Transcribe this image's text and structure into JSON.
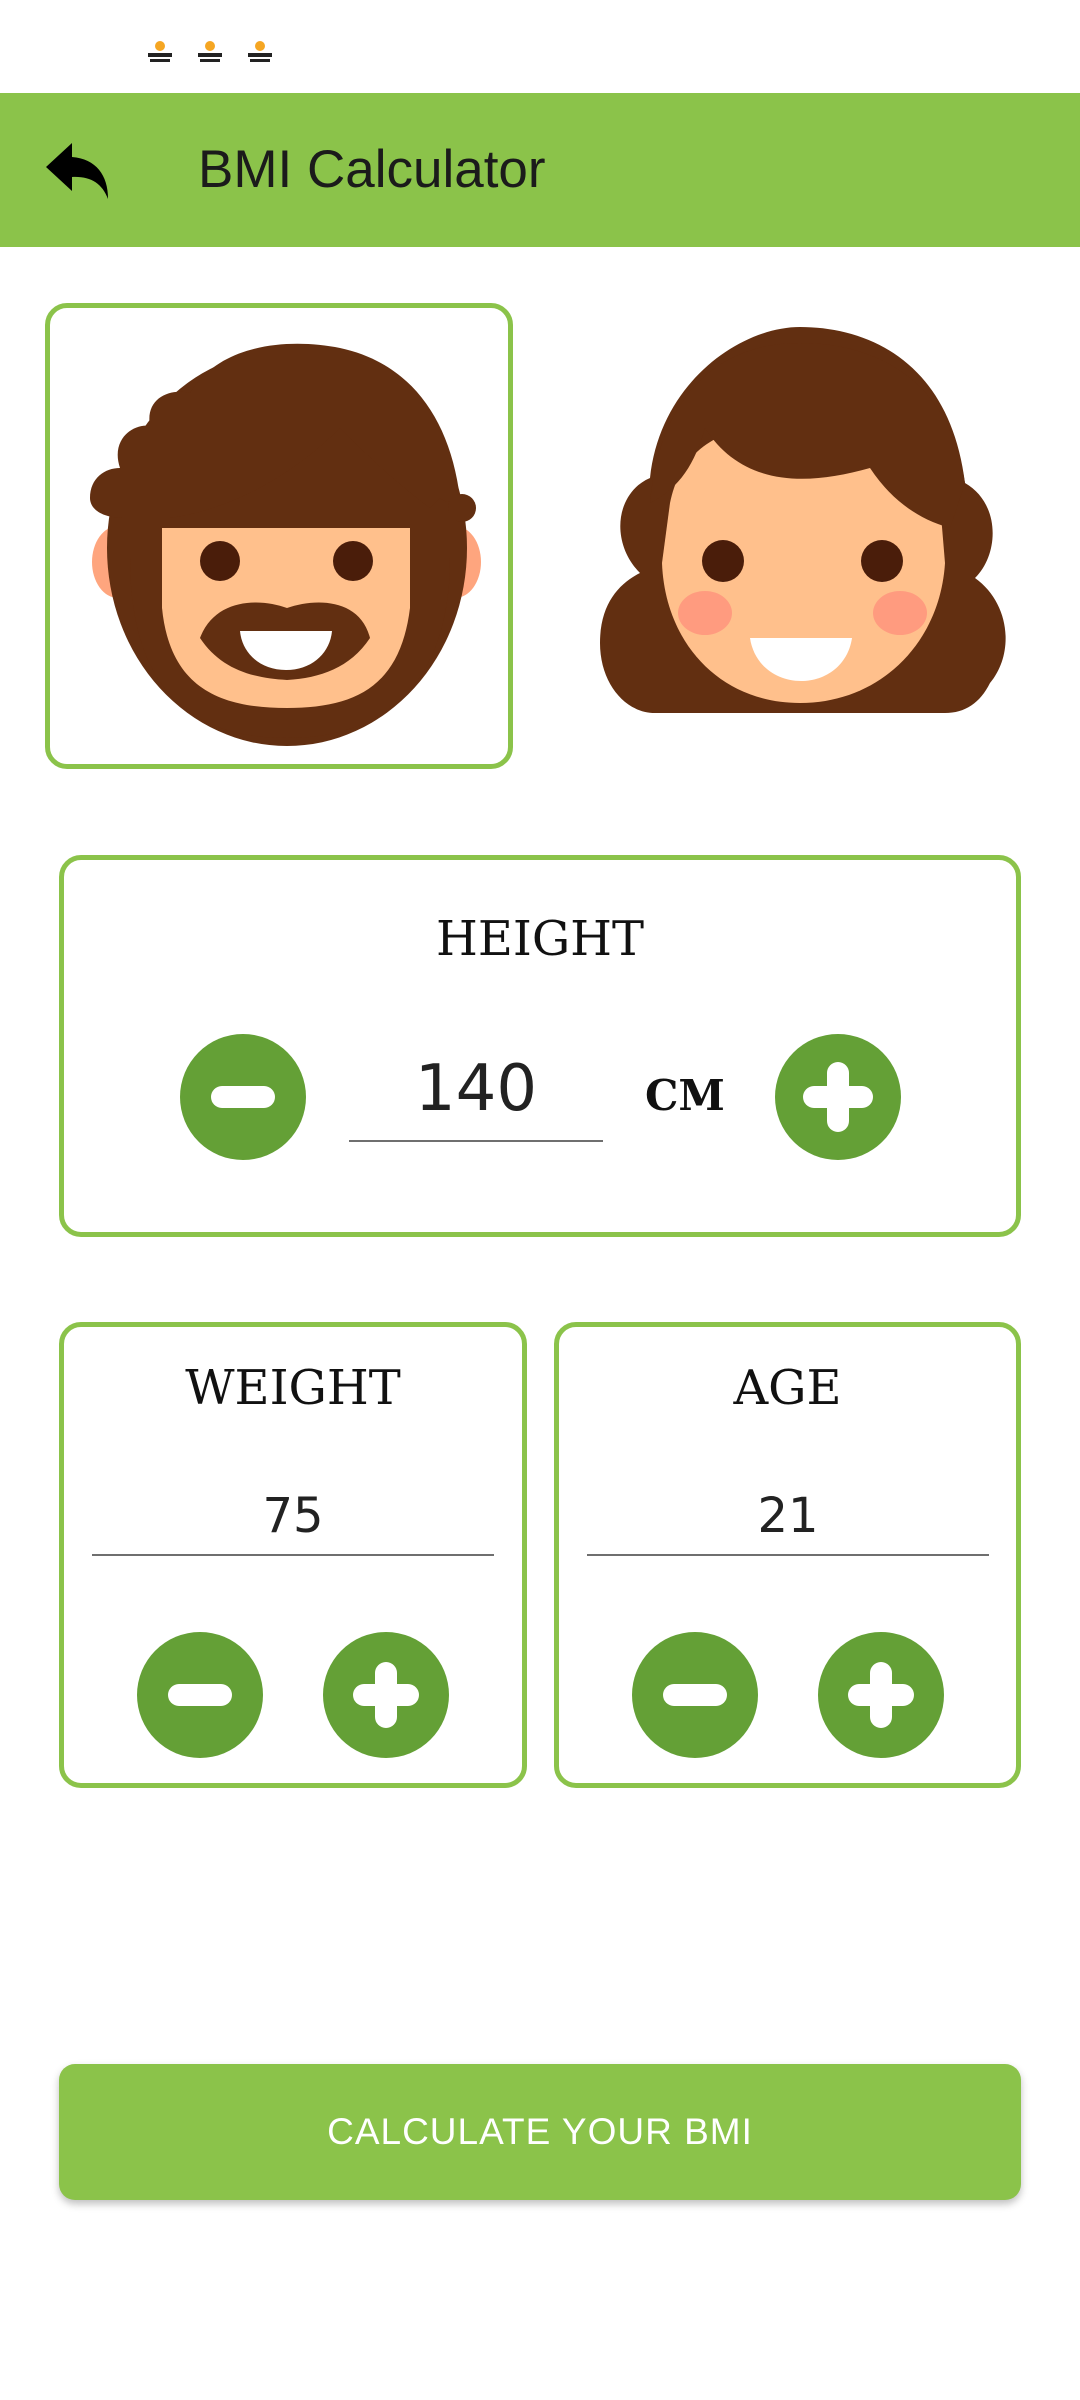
{
  "toolbar": {
    "title": "BMI Calculator"
  },
  "gender": {
    "male": {
      "selected": true
    },
    "female": {
      "selected": false
    }
  },
  "height": {
    "label": "HEIGHT",
    "value": "140",
    "unit": "CM"
  },
  "weight": {
    "label": "WEIGHT",
    "value": "75"
  },
  "age": {
    "label": "AGE",
    "value": "21"
  },
  "calculate": {
    "label": "CALCULATE YOUR BMI"
  },
  "colors": {
    "accent": "#8bc34a",
    "button_dark": "#64a036",
    "hair": "#622f11",
    "skin": "#ffc08c"
  },
  "icons": [
    "notification-icon",
    "back-arrow-icon",
    "male-avatar-icon",
    "female-avatar-icon",
    "minus-icon",
    "plus-icon"
  ]
}
